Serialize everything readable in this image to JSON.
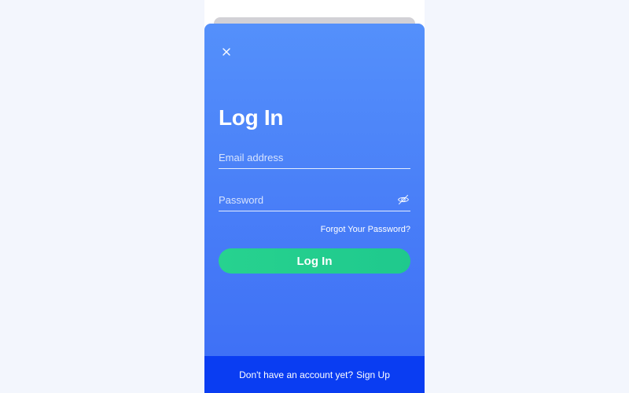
{
  "colors": {
    "page_background": "#f3f6fd",
    "modal_gradient_top": "#5490fb",
    "modal_gradient_bottom": "#3c6df5",
    "primary_button": "#27d28f",
    "footer_background": "#0a3df2",
    "text": "#ffffff"
  },
  "modal": {
    "close_icon": "close-icon",
    "title": "Log In",
    "email": {
      "placeholder": "Email address",
      "value": ""
    },
    "password": {
      "placeholder": "Password",
      "value": "",
      "toggle_icon": "eye-off-icon"
    },
    "forgot_password_label": "Forgot Your Password?",
    "login_button_label": "Log In"
  },
  "footer": {
    "prompt": "Don't have an account yet?",
    "signup_label": "Sign Up"
  }
}
